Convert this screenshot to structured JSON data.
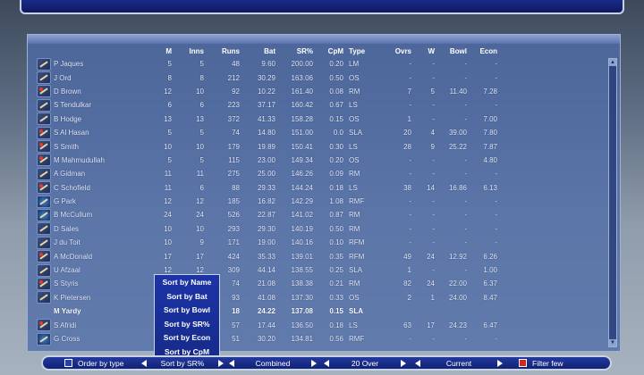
{
  "columns": [
    "",
    "",
    "M",
    "Inns",
    "Runs",
    "Bat",
    "SR%",
    "CpM",
    "Type",
    "Ovrs",
    "W",
    "Bowl",
    "Econ"
  ],
  "players": [
    {
      "icon": "bat-icon",
      "name": "P Jaques",
      "m": "5",
      "inns": "5",
      "runs": "48",
      "bat": "9.60",
      "sr": "200.00",
      "cpm": "0.20",
      "type": "LM",
      "ovrs": "-",
      "w": "-",
      "bowl": "-",
      "econ": "-"
    },
    {
      "icon": "bat-icon",
      "name": "J Ord",
      "m": "8",
      "inns": "8",
      "runs": "212",
      "bat": "30.29",
      "sr": "163.06",
      "cpm": "0.50",
      "type": "OS",
      "ovrs": "-",
      "w": "-",
      "bowl": "-",
      "econ": "-"
    },
    {
      "icon": "bowl-icon",
      "name": "D Brown",
      "m": "12",
      "inns": "10",
      "runs": "92",
      "bat": "10.22",
      "sr": "161.40",
      "cpm": "0.08",
      "type": "RM",
      "ovrs": "7",
      "w": "5",
      "bowl": "11.40",
      "econ": "7.28"
    },
    {
      "icon": "bat-icon",
      "name": "S Tendulkar",
      "m": "6",
      "inns": "6",
      "runs": "223",
      "bat": "37.17",
      "sr": "160.42",
      "cpm": "0.67",
      "type": "LS",
      "ovrs": "-",
      "w": "-",
      "bowl": "-",
      "econ": "-"
    },
    {
      "icon": "bat-icon",
      "name": "B Hodge",
      "m": "13",
      "inns": "13",
      "runs": "372",
      "bat": "41.33",
      "sr": "158.28",
      "cpm": "0.15",
      "type": "OS",
      "ovrs": "1",
      "w": "-",
      "bowl": "-",
      "econ": "7.00"
    },
    {
      "icon": "bowl-icon",
      "name": "S Al Hasan",
      "m": "5",
      "inns": "5",
      "runs": "74",
      "bat": "14.80",
      "sr": "151.00",
      "cpm": "0.0",
      "type": "SLA",
      "ovrs": "20",
      "w": "4",
      "bowl": "39.00",
      "econ": "7.80"
    },
    {
      "icon": "bowl-icon",
      "name": "S Smith",
      "m": "10",
      "inns": "10",
      "runs": "179",
      "bat": "19.89",
      "sr": "150.41",
      "cpm": "0.30",
      "type": "LS",
      "ovrs": "28",
      "w": "9",
      "bowl": "25.22",
      "econ": "7.87"
    },
    {
      "icon": "bowl-icon",
      "name": "M Mahmudullah",
      "m": "5",
      "inns": "5",
      "runs": "115",
      "bat": "23.00",
      "sr": "149.34",
      "cpm": "0.20",
      "type": "OS",
      "ovrs": "-",
      "w": "-",
      "bowl": "-",
      "econ": "4.80"
    },
    {
      "icon": "bat-icon",
      "name": "A Gidman",
      "m": "11",
      "inns": "11",
      "runs": "275",
      "bat": "25.00",
      "sr": "146.26",
      "cpm": "0.09",
      "type": "RM",
      "ovrs": "-",
      "w": "-",
      "bowl": "-",
      "econ": "-"
    },
    {
      "icon": "bowl-icon",
      "name": "C Schofield",
      "m": "11",
      "inns": "6",
      "runs": "88",
      "bat": "29.33",
      "sr": "144.24",
      "cpm": "0.18",
      "type": "LS",
      "ovrs": "38",
      "w": "14",
      "bowl": "16.86",
      "econ": "6.13"
    },
    {
      "icon": "keeper-icon",
      "name": "G Park",
      "m": "12",
      "inns": "12",
      "runs": "185",
      "bat": "16.82",
      "sr": "142.29",
      "cpm": "1.08",
      "type": "RMF",
      "ovrs": "-",
      "w": "-",
      "bowl": "-",
      "econ": "-"
    },
    {
      "icon": "keeper-icon",
      "name": "B McCullum",
      "m": "24",
      "inns": "24",
      "runs": "526",
      "bat": "22.87",
      "sr": "141.02",
      "cpm": "0.87",
      "type": "RM",
      "ovrs": "-",
      "w": "-",
      "bowl": "-",
      "econ": "-"
    },
    {
      "icon": "bat-icon",
      "name": "D Sales",
      "m": "10",
      "inns": "10",
      "runs": "293",
      "bat": "29.30",
      "sr": "140.19",
      "cpm": "0.50",
      "type": "RM",
      "ovrs": "-",
      "w": "-",
      "bowl": "-",
      "econ": "-"
    },
    {
      "icon": "bat-icon",
      "name": "J du Toit",
      "m": "10",
      "inns": "9",
      "runs": "171",
      "bat": "19.00",
      "sr": "140.16",
      "cpm": "0.10",
      "type": "RFM",
      "ovrs": "-",
      "w": "-",
      "bowl": "-",
      "econ": "-"
    },
    {
      "icon": "bowl-icon",
      "name": "A McDonald",
      "m": "17",
      "inns": "17",
      "runs": "424",
      "bat": "35.33",
      "sr": "139.01",
      "cpm": "0.35",
      "type": "RFM",
      "ovrs": "49",
      "w": "24",
      "bowl": "12.92",
      "econ": "6.26"
    },
    {
      "icon": "bat-icon",
      "name": "U Afzaal",
      "m": "12",
      "inns": "12",
      "runs": "309",
      "bat": "44.14",
      "sr": "138.55",
      "cpm": "0.25",
      "type": "SLA",
      "ovrs": "1",
      "w": "-",
      "bowl": "-",
      "econ": "1.00"
    },
    {
      "icon": "bowl-icon",
      "name": "S Styris",
      "m": "",
      "inns": "",
      "runs": "74",
      "bat": "21.08",
      "sr": "138.38",
      "cpm": "0.21",
      "type": "RM",
      "ovrs": "82",
      "w": "24",
      "bowl": "22.00",
      "econ": "6.37"
    },
    {
      "icon": "bat-icon",
      "name": "K Pietersen",
      "m": "",
      "inns": "",
      "runs": "93",
      "bat": "41.08",
      "sr": "137.30",
      "cpm": "0.33",
      "type": "OS",
      "ovrs": "2",
      "w": "1",
      "bowl": "24.00",
      "econ": "8.47"
    },
    {
      "icon": "",
      "name": "M Yardy",
      "m": "",
      "inns": "",
      "runs": "18",
      "bat": "24.22",
      "sr": "137.08",
      "cpm": "0.15",
      "type": "SLA",
      "ovrs": "",
      "w": "",
      "bowl": "",
      "econ": "",
      "selected": true
    },
    {
      "icon": "bowl-icon",
      "name": "S Afridi",
      "m": "",
      "inns": "",
      "runs": "57",
      "bat": "17.44",
      "sr": "136.50",
      "cpm": "0.18",
      "type": "LS",
      "ovrs": "63",
      "w": "17",
      "bowl": "24.23",
      "econ": "6.47"
    },
    {
      "icon": "keeper-icon",
      "name": "G Cross",
      "m": "",
      "inns": "",
      "runs": "51",
      "bat": "30.20",
      "sr": "134.81",
      "cpm": "0.56",
      "type": "RMF",
      "ovrs": "-",
      "w": "-",
      "bowl": "-",
      "econ": "-"
    }
  ],
  "sort_menu": [
    "Sort by Name",
    "Sort by Bat",
    "Sort by Bowl",
    "Sort by SR%",
    "Sort by Econ",
    "Sort by CpM"
  ],
  "bottom_bar": {
    "order_by_type": "Order by type",
    "sort": "Sort by SR%",
    "mode": "Combined",
    "format": "20 Over",
    "period": "Current",
    "filter": "Filter few"
  }
}
